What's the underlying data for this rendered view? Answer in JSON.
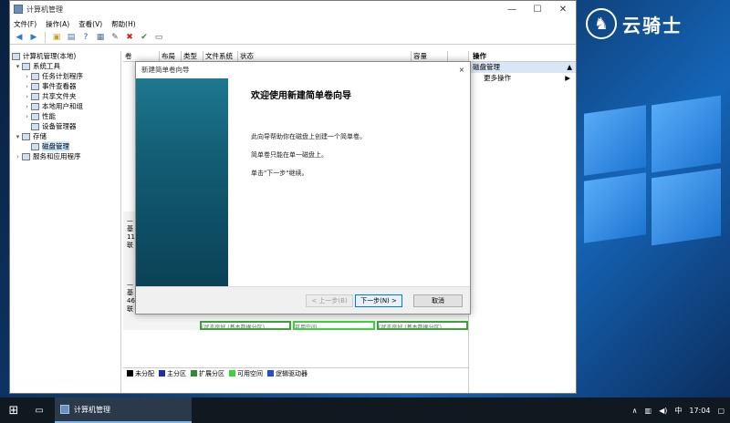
{
  "window": {
    "title": "计算机管理",
    "minimize": "—",
    "maximize": "☐",
    "close": "✕"
  },
  "menu": [
    "文件(F)",
    "操作(A)",
    "查看(V)",
    "帮助(H)"
  ],
  "tree": [
    {
      "label": "计算机管理(本地)",
      "level": 0,
      "exp": "",
      "selected": false
    },
    {
      "label": "系统工具",
      "level": 1,
      "exp": "▾",
      "selected": false
    },
    {
      "label": "任务计划程序",
      "level": 2,
      "exp": "›",
      "selected": false
    },
    {
      "label": "事件查看器",
      "level": 2,
      "exp": "›",
      "selected": false
    },
    {
      "label": "共享文件夹",
      "level": 2,
      "exp": "›",
      "selected": false
    },
    {
      "label": "本地用户和组",
      "level": 2,
      "exp": "›",
      "selected": false
    },
    {
      "label": "性能",
      "level": 2,
      "exp": "›",
      "selected": false
    },
    {
      "label": "设备管理器",
      "level": 2,
      "exp": "",
      "selected": false
    },
    {
      "label": "存储",
      "level": 1,
      "exp": "▾",
      "selected": false
    },
    {
      "label": "磁盘管理",
      "level": 2,
      "exp": "",
      "selected": true
    },
    {
      "label": "服务和应用程序",
      "level": 1,
      "exp": "›",
      "selected": false
    }
  ],
  "columns": [
    "卷",
    "布局",
    "类型",
    "文件系统",
    "状态",
    "容量"
  ],
  "disk_rows": [
    {
      "l1": "—",
      "l2": "基",
      "l3": "11",
      "l4": "联"
    },
    {
      "l1": "—",
      "l2": "基",
      "l3": "46",
      "l4": "联"
    }
  ],
  "partitions": [
    "(状态良好 (基本数据分区)",
    "可用空间",
    "(状态良好 (基本数据分区)"
  ],
  "legend": [
    {
      "label": "未分配",
      "color": "#000000"
    },
    {
      "label": "主分区",
      "color": "#1a2fa8"
    },
    {
      "label": "扩展分区",
      "color": "#2e8b2e"
    },
    {
      "label": "可用空间",
      "color": "#3ad33a"
    },
    {
      "label": "逻辑驱动器",
      "color": "#1c4ed8"
    }
  ],
  "actions": {
    "header": "操作",
    "section": "磁盘管理",
    "section_arrow": "▲",
    "more": "更多操作",
    "more_arrow": "▶"
  },
  "wizard": {
    "title": "新建简单卷向导",
    "close": "×",
    "heading": "欢迎使用新建简单卷向导",
    "p1": "此向导帮助你在磁盘上创建一个简单卷。",
    "p2": "简单卷只能在单一磁盘上。",
    "p3": "单击\"下一步\"继续。",
    "back": "< 上一步(B)",
    "next": "下一步(N) >",
    "cancel": "取消"
  },
  "brand": {
    "text": "云骑士"
  },
  "taskbar": {
    "start": "⊞",
    "app_label": "计算机管理",
    "tray_arrow": "∧",
    "ime": "中",
    "time": "17:04"
  }
}
